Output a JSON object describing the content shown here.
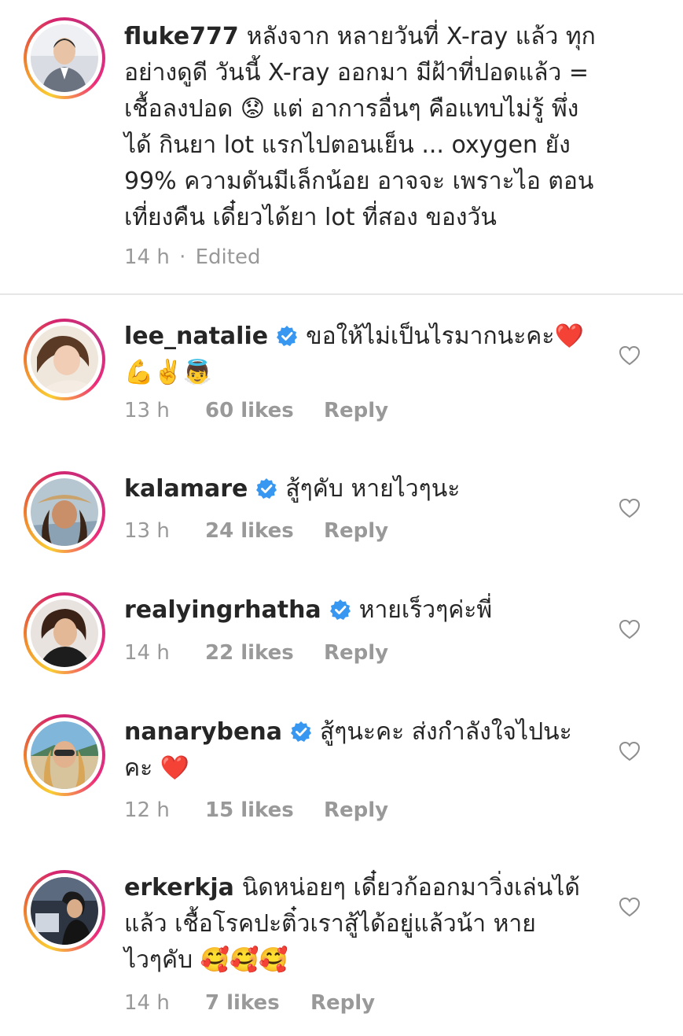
{
  "caption": {
    "username": "fluke777",
    "lines": [
      "หลังจาก หลายวันที่ X-ray แล้ว ทุก",
      "อย่างดูดี วันนี้ X-ray ออกมา มีฝ้าที่ปอดแล้ว =",
      "เชื้อลงปอด 😟 แต่ อาการอื่นๆ คือแทบไม่รู้ พึ่ง",
      "ได้ กินยา lot แรกไปตอนเย็น ... oxygen ยัง",
      "99% ความดันมีเล็กน้อย อาจจะ เพราะไอ ตอน",
      "เที่ยงคืน เดี๋ยวได้ยา lot ที่สอง ของวัน"
    ],
    "time": "14 h",
    "separator": "·",
    "edited": "Edited"
  },
  "comments": [
    {
      "username": "lee_natalie",
      "verified": true,
      "lines": [
        "ขอให้ไม่เป็นไรมากนะคะ❤️",
        "💪✌️👼"
      ],
      "time": "13 h",
      "likes": "60 likes",
      "reply": "Reply"
    },
    {
      "username": "kalamare",
      "verified": true,
      "lines": [
        "สู้ๆคับ หายไวๆนะ"
      ],
      "time": "13 h",
      "likes": "24 likes",
      "reply": "Reply"
    },
    {
      "username": "realyingrhatha",
      "verified": true,
      "lines": [
        "หายเร็วๆค่ะพี่"
      ],
      "time": "14 h",
      "likes": "22 likes",
      "reply": "Reply"
    },
    {
      "username": "nanarybena",
      "verified": true,
      "lines": [
        "สู้ๆนะคะ ส่งกำลังใจไปนะ",
        "คะ ❤️"
      ],
      "time": "12 h",
      "likes": "15 likes",
      "reply": "Reply"
    },
    {
      "username": "erkerkja",
      "verified": false,
      "lines": [
        "นิดหน่อยๆ เดี๋ยวก้ออกมาวิ่งเล่นได้",
        "แล้ว เชื้อโรคปะติ๋วเราสู้ได้อยู่แล้วน้า หาย",
        "ไวๆคับ 🥰🥰🥰"
      ],
      "time": "14 h",
      "likes": "7 likes",
      "reply": "Reply"
    }
  ],
  "icons": {
    "like": "heart-outline-icon",
    "verified": "verified-badge-icon"
  },
  "colors": {
    "text": "#262626",
    "meta": "#999999",
    "verified": "#3897f0",
    "divider": "#e6e6e6"
  }
}
